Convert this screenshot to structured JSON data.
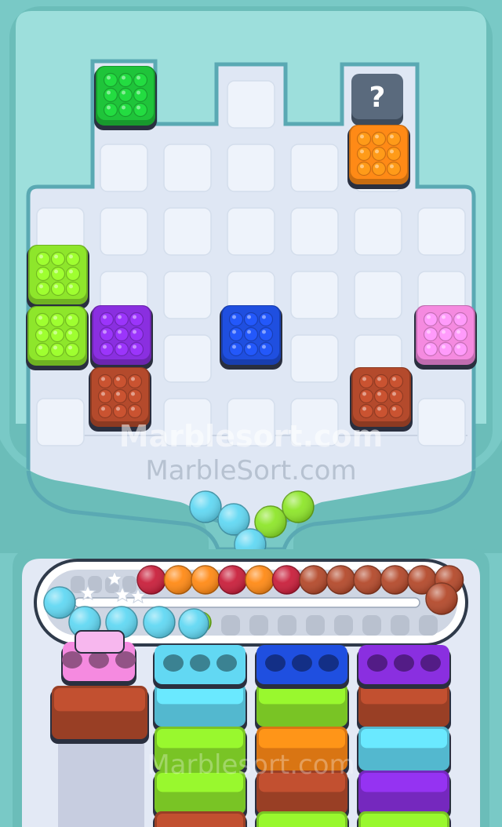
{
  "watermark": {
    "top": "Marblesort.com",
    "bottom": "MarbleSort.com",
    "footer": "Marblesort.com"
  },
  "mystery_label": "?",
  "colors": {
    "green": "#1fc43a",
    "lime": "#8ee62b",
    "orange": "#ff8a16",
    "purple": "#8a2fe0",
    "blue": "#1f4fe0",
    "pink": "#f58ae0",
    "brown": "#b44a2c",
    "cyan": "#62d8f3",
    "red": "#c9203c",
    "board": "#dfe7f4",
    "tile": "#eef3fb",
    "frame": "#6bbdb9"
  },
  "board": {
    "columns": 7,
    "rows": 6,
    "blocks": [
      {
        "id": "green-top",
        "color": "green",
        "col": 1,
        "row": 0
      },
      {
        "id": "mystery",
        "color": "mystery",
        "col": 6,
        "row": 0
      },
      {
        "id": "orange-top",
        "color": "orange",
        "col": 6,
        "row": 1
      },
      {
        "id": "lime-upper",
        "color": "lime",
        "col": 0,
        "row": 3
      },
      {
        "id": "lime-lower",
        "color": "lime",
        "col": 0,
        "row": 4
      },
      {
        "id": "purple",
        "color": "purple",
        "col": 1,
        "row": 4
      },
      {
        "id": "blue",
        "color": "blue",
        "col": 3,
        "row": 4
      },
      {
        "id": "pink",
        "color": "pink",
        "col": 7,
        "row": 4
      },
      {
        "id": "brown-left",
        "color": "brown",
        "col": 1,
        "row": 5
      },
      {
        "id": "brown-right",
        "color": "brown",
        "col": 6,
        "row": 5
      }
    ]
  },
  "funnel_marbles": [
    "cyan",
    "cyan",
    "lime",
    "lime",
    "cyan"
  ],
  "conveyor": {
    "top_row": [
      "red",
      "orange",
      "orange",
      "red",
      "orange",
      "red",
      "brown",
      "brown",
      "brown",
      "brown",
      "brown",
      "brown"
    ],
    "bottom_row": [
      "cyan",
      "cyan",
      "cyan",
      "cyan",
      "cyan",
      "lime"
    ],
    "stars": 4
  },
  "sorting_columns": [
    {
      "tray": "pink",
      "trays_below": [
        "brown",
        "gray"
      ]
    },
    {
      "tray": "cyan",
      "trays_below": [
        "cyan",
        "lime",
        "lime",
        "brown"
      ]
    },
    {
      "tray": "blue",
      "trays_below": [
        "lime",
        "orange",
        "brown",
        "lime"
      ]
    },
    {
      "tray": "purple",
      "trays_below": [
        "brown",
        "cyan",
        "purple",
        "lime"
      ]
    }
  ]
}
